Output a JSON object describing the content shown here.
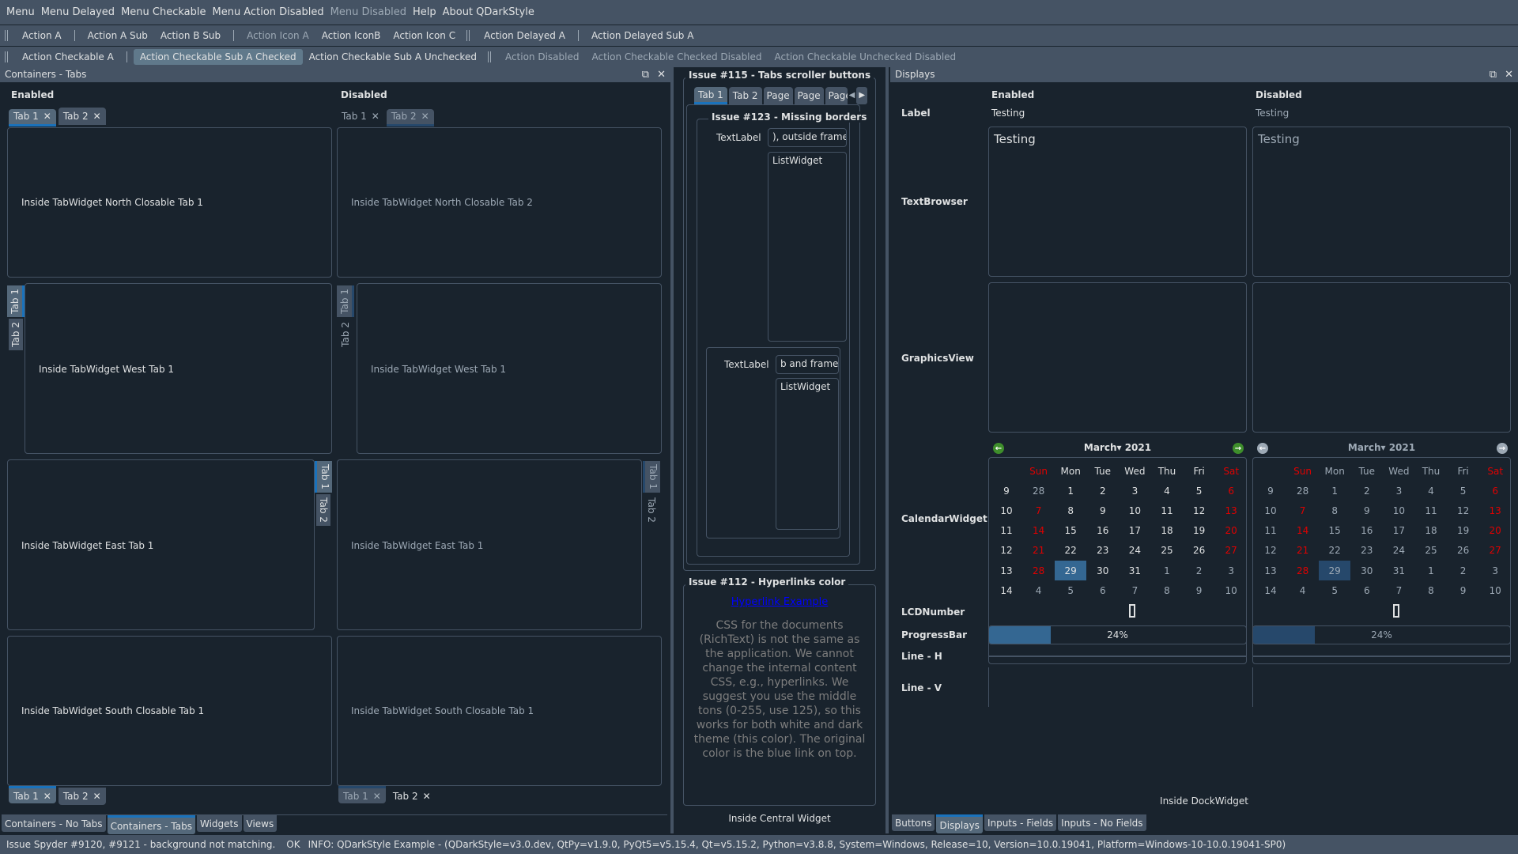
{
  "menubar": {
    "items": [
      {
        "label": "Menu",
        "disabled": false
      },
      {
        "label": "Menu Delayed",
        "disabled": false
      },
      {
        "label": "Menu Checkable",
        "disabled": false
      },
      {
        "label": "Menu Action Disabled",
        "disabled": false
      },
      {
        "label": "Menu Disabled",
        "disabled": true
      },
      {
        "label": "Help",
        "disabled": false
      },
      {
        "label": "About QDarkStyle",
        "disabled": false
      }
    ]
  },
  "toolbar1": {
    "action_a": "Action A",
    "action_a_sub": "Action A Sub",
    "action_b_sub": "Action B Sub",
    "action_icon_a": "Action Icon A",
    "action_iconb": "Action IconB",
    "action_icon_c": "Action Icon C",
    "action_delayed_a": "Action Delayed A",
    "action_delayed_sub_a": "Action Delayed Sub A"
  },
  "toolbar2": {
    "checkable_a": "Action Checkable A",
    "checkable_sub_checked": "Action Checkable Sub A Checked",
    "checkable_sub_unchecked": "Action Checkable Sub A Unchecked",
    "disabled": "Action Disabled",
    "checked_disabled": "Action Checkable Checked Disabled",
    "unchecked_disabled": "Action Checkable Unchecked Disabled"
  },
  "left_dock": {
    "title": "Containers - Tabs",
    "enabled_label": "Enabled",
    "disabled_label": "Disabled",
    "tab1": "Tab 1",
    "tab2": "Tab 2",
    "close_glyph": "✕",
    "north_en": "Inside TabWidget North Closable Tab 1",
    "north_dis": "Inside TabWidget North Closable Tab 2",
    "west_en": "Inside TabWidget West Tab 1",
    "west_dis": "Inside TabWidget West Tab 1",
    "east_en": "Inside TabWidget East Tab 1",
    "east_dis": "Inside TabWidget East Tab 1",
    "south_en": "Inside TabWidget South Closable Tab 1",
    "south_dis": "Inside TabWidget South Closable Tab 1",
    "bottom_tabs": [
      "Containers - No Tabs",
      "Containers - Tabs",
      "Widgets",
      "Views"
    ],
    "bottom_selected": 1
  },
  "central": {
    "issue115_title": "Issue #115 - Tabs scroller buttons",
    "scroller_tabs": [
      "Tab 1",
      "Tab 2",
      "Page",
      "Page",
      "Page"
    ],
    "issue123_title": "Issue #123 - Missing borders",
    "textlabel1": "TextLabel",
    "field1_value": "), outside frame",
    "list1": "ListWidget",
    "textlabel2": "TextLabel",
    "field2_value": "b and frame",
    "list2": "ListWidget",
    "issue112_title": "Issue #112 - Hyperlinks color",
    "hyperlink": "Hyperlink Example",
    "hyperlink_color": "#0000FF",
    "richtext": "CSS for the documents (RichText) is not the same as the application. We cannot change the internal content CSS, e.g., hyperlinks. We suggest you use the middle tons (0-255, use 125), so this works for both white and dark theme (this color). The original color is the blue link on top.",
    "footer": "Inside Central Widget"
  },
  "right_dock": {
    "title": "Displays",
    "enabled_label": "Enabled",
    "disabled_label": "Disabled",
    "rows": {
      "label": "Label",
      "textbrowser": "TextBrowser",
      "graphicsview": "GraphicsView",
      "calendar": "CalendarWidget",
      "lcd": "LCDNumber",
      "progress": "ProgressBar",
      "line_h": "Line - H",
      "line_v": "Line - V"
    },
    "label_value": "Testing",
    "textbrowser_value": "Testing",
    "calendar": {
      "month": "March",
      "year": "2021",
      "headers": [
        "Sun",
        "Mon",
        "Tue",
        "Wed",
        "Thu",
        "Fri",
        "Sat"
      ],
      "weeks": [
        9,
        10,
        11,
        12,
        13,
        14
      ],
      "days": [
        [
          28,
          1,
          2,
          3,
          4,
          5,
          6
        ],
        [
          7,
          8,
          9,
          10,
          11,
          12,
          13
        ],
        [
          14,
          15,
          16,
          17,
          18,
          19,
          20
        ],
        [
          21,
          22,
          23,
          24,
          25,
          26,
          27
        ],
        [
          28,
          29,
          30,
          31,
          1,
          2,
          3
        ],
        [
          4,
          5,
          6,
          7,
          8,
          9,
          10
        ]
      ],
      "selected": 29
    },
    "lcd_value": "0",
    "progress_value": 24,
    "progress_text": "24%",
    "footer": "Inside DockWidget",
    "bottom_tabs": [
      "Buttons",
      "Displays",
      "Inputs - Fields",
      "Inputs - No Fields"
    ],
    "bottom_selected": 1
  },
  "statusbar": {
    "message": "Issue Spyder #9120, #9121 - background not matching.",
    "ok": "OK",
    "info": "INFO: QDarkStyle Example - (QDarkStyle=v3.0.dev, QtPy=v1.9.0, PyQt5=v5.15.4, Qt=v5.15.2, Python=v3.8.8, System=Windows, Release=10, Version=10.0.19041, Platform=Windows-10-10.0.19041-SP0)"
  }
}
